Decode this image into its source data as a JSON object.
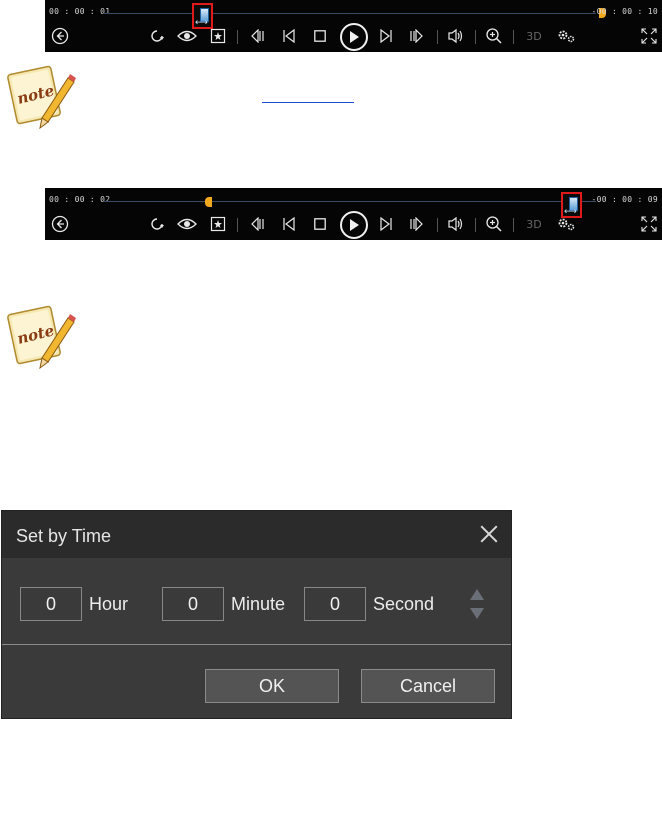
{
  "player1": {
    "elapsed": "00 : 00 : 01",
    "remaining": "-00 : 00 : 10",
    "label_3d": "3D"
  },
  "player2": {
    "elapsed": "00 : 00 : 02",
    "remaining": "-00 : 00 : 09",
    "label_3d": "3D"
  },
  "icons": [
    "back-icon",
    "repeat-icon",
    "eye-icon",
    "snapshot-icon",
    "prev-chapter-icon",
    "step-back-icon",
    "stop-icon",
    "play-icon",
    "step-forward-icon",
    "next-chapter-icon",
    "volume-icon",
    "zoom-icon",
    "settings-icon",
    "fullscreen-icon"
  ],
  "note_icon_label": "note",
  "dialog": {
    "title": "Set by Time",
    "hour_value": "0",
    "hour_label": "Hour",
    "minute_value": "0",
    "minute_label": "Minute",
    "second_value": "0",
    "second_label": "Second",
    "ok_label": "OK",
    "cancel_label": "Cancel"
  },
  "colors": {
    "accent_marker": "#f2a81d",
    "highlight_box": "#e01a1a",
    "dialog_bg": "#3a3a3a",
    "dialog_title_bg": "#2b2b2b"
  }
}
